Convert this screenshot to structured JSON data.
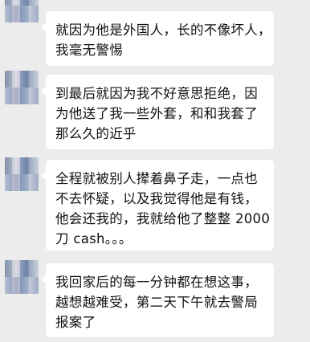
{
  "messages": [
    {
      "lines": [
        "就因为他是外国人，长的不像坏人，",
        "我毫无警惕"
      ]
    },
    {
      "lines": [
        "到最后就因为我不好意思拒绝，因",
        "为他送了我一些外套，和和我套了",
        "那么久的近乎"
      ]
    },
    {
      "lines": [
        "全程就被别人撵着鼻子走，一点也",
        "不去怀疑，以及我觉得他是有钱，",
        "他会还我的，我就给他了整整 2000",
        "刀 cash。。。"
      ]
    },
    {
      "lines": [
        "我回家后的每一分钟都在想这事，",
        "越想越难受，第二天下午就去警局",
        "报案了"
      ]
    }
  ]
}
